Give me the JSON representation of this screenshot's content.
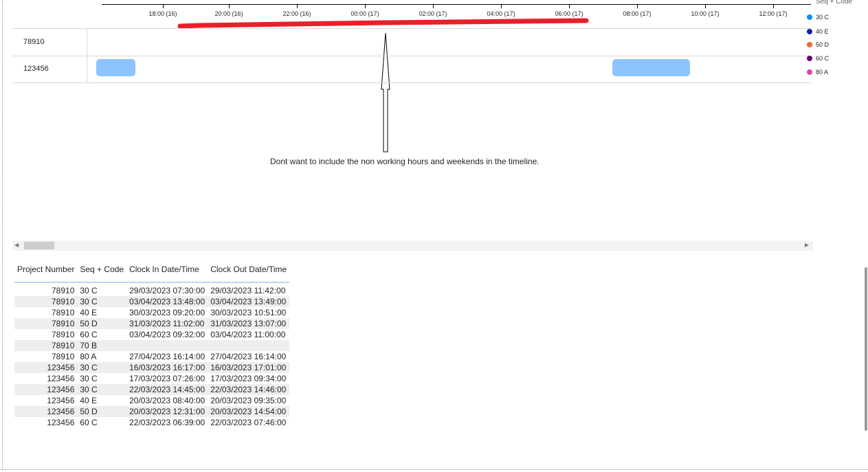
{
  "timeline": {
    "ticks": [
      "18:00 (16)",
      "20:00 (16)",
      "22:00 (16)",
      "00:00 (17)",
      "02:00 (17)",
      "04:00 (17)",
      "06:00 (17)",
      "08:00 (17)",
      "10:00 (17)",
      "12:00 (17)"
    ],
    "rows": [
      {
        "label": "78910"
      },
      {
        "label": "123456"
      }
    ],
    "highlight_color": "#e8202a",
    "bar_color": "#8cc4ff"
  },
  "legend": {
    "title": "Seq + Code",
    "items": [
      {
        "label": "30 C",
        "color": "#118dff"
      },
      {
        "label": "40 E",
        "color": "#12239e"
      },
      {
        "label": "50 D",
        "color": "#e66c37"
      },
      {
        "label": "60 C",
        "color": "#6b007b"
      },
      {
        "label": "80 A",
        "color": "#e044a7"
      }
    ]
  },
  "annotation": {
    "text": "Dont want to include the non working hours and weekends in the timeline."
  },
  "table": {
    "headers": [
      "Project Number",
      "Seq + Code",
      "Clock In Date/Time",
      "Clock Out Date/Time"
    ],
    "rows": [
      [
        "78910",
        "30 C",
        "29/03/2023 07:30:00",
        "29/03/2023 11:42:00"
      ],
      [
        "78910",
        "30 C",
        "03/04/2023 13:48:00",
        "03/04/2023 13:49:00"
      ],
      [
        "78910",
        "40 E",
        "30/03/2023 09:20:00",
        "30/03/2023 10:51:00"
      ],
      [
        "78910",
        "50 D",
        "31/03/2023 11:02:00",
        "31/03/2023 13:07:00"
      ],
      [
        "78910",
        "60 C",
        "03/04/2023 09:32:00",
        "03/04/2023 11:00:00"
      ],
      [
        "78910",
        "70 B",
        "",
        ""
      ],
      [
        "78910",
        "80 A",
        "27/04/2023 16:14:00",
        "27/04/2023 16:14:00"
      ],
      [
        "123456",
        "30 C",
        "16/03/2023 16:17:00",
        "16/03/2023 17:01:00"
      ],
      [
        "123456",
        "30 C",
        "17/03/2023 07:26:00",
        "17/03/2023 09:34:00"
      ],
      [
        "123456",
        "30 C",
        "22/03/2023 14:45:00",
        "22/03/2023 14:46:00"
      ],
      [
        "123456",
        "40 E",
        "20/03/2023 08:40:00",
        "20/03/2023 09:35:00"
      ],
      [
        "123456",
        "50 D",
        "20/03/2023 12:31:00",
        "20/03/2023 14:54:00"
      ],
      [
        "123456",
        "60 C",
        "22/03/2023 06:39:00",
        "22/03/2023 07:46:00"
      ]
    ]
  }
}
